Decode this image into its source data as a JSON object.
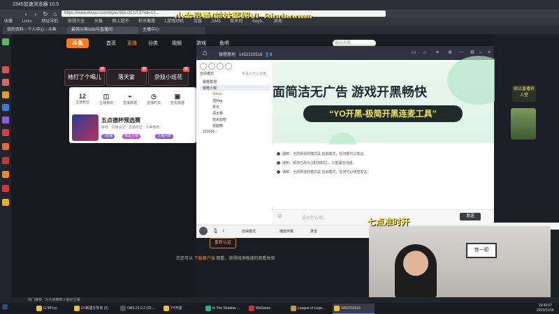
{
  "browser": {
    "title": "2345加速浏览器 10.5",
    "url": "https://www.douyu.com/topic/SOLOCUTZ?rid=12...",
    "overlay_title": "小金灵勇/前妹薪妞VL Bigdaopwa",
    "bookmarks": [
      "收藏",
      "Links",
      "网址导航",
      "影视大全",
      "天猫",
      "网上超市",
      "秒杀聚惠",
      "L游戏动机",
      "百度",
      "2345",
      "新乡的",
      "Keyb..",
      "其他"
    ],
    "tabs": [
      "我的资料 - 个人中心 - 斗鱼",
      "最强斗鱼solo与直播间",
      "主播中心"
    ]
  },
  "douyu": {
    "logo": "斗鱼",
    "nav": [
      "首页",
      "直播",
      "分类",
      "视频",
      "游戏",
      "鱼吧"
    ],
    "search_placeholder": "BIG大鱼",
    "hot_cards": [
      "她打了个喝儿",
      "落天宴",
      "杂技小班花"
    ],
    "hot_badge": "新",
    "stats": [
      {
        "value": "12",
        "label": "主播积分"
      },
      {
        "value": "",
        "label": "主播等级"
      },
      {
        "value": "",
        "label": "直播数据"
      },
      {
        "value": "",
        "label": "直播时长"
      },
      {
        "value": "",
        "label": "查看数据"
      }
    ],
    "stream_title": "五点德杯预选赛",
    "stream_sub": "审核 · 风格设定 · 直播类型 · 大神推荐",
    "chips": [
      "V首播",
      "我是主播",
      "主播列表"
    ],
    "bottom_button": "重新认证",
    "bottom_tip_pre": "您还可以 ",
    "bottom_tip_hl": "下载客户端",
    "bottom_tip_post": " 观看，获得纯净极速的观看体验"
  },
  "yy": {
    "channel_name": "银橙基地",
    "channel_id": "1452215516",
    "online_count": "6",
    "mode": "自由模式",
    "mode_sub": "有事人可以加麦",
    "tree": [
      "银橙基地",
      "银橙小窝",
      "Sleyal",
      "洁Hng",
      "月光",
      "深大英",
      "亚大的粉",
      "张韵鸭",
      "121516"
    ],
    "banner_line1": "面简洁无广告  游戏开黑畅快",
    "banner_pill": "“YO开黑-极简开黑连麦工具”",
    "notices": [
      "通知：当前频道的模式是 自由模式，任何都可以发言。",
      "通知：频道已改为 [语音模式] ，只能语音沟通。",
      "通知：当前频道的模式是 自由模式，任何可以随意发言。"
    ],
    "chat_placeholder": "说点什么吧...",
    "send_label": "发送",
    "footer_items": [
      "自由模式",
      "播放伴奏",
      "录音"
    ]
  },
  "right": {
    "rank_label": "阔以直播名人堂",
    "webcam_title": "七点准时开"
  },
  "webcam": {
    "frame_text": "世一初"
  },
  "status_bar": "热门推荐 · 为大家推荐斗鱼好主播",
  "taskbar": {
    "items": [
      "G:\\PF\\yy",
      "D:\\新建文件夹 (2)",
      "OBS 22.0.2 (32-...",
      "YY开黑",
      "In The Shadow ...",
      "WeGame",
      "League of Lego...",
      "1452215516"
    ],
    "time": "19:46:07",
    "date": "2022/11/16"
  },
  "colors": {
    "brand_orange": "#ff7a1a",
    "overlay_yellow": "#f7e44a",
    "yy_dark": "#2f3340"
  }
}
